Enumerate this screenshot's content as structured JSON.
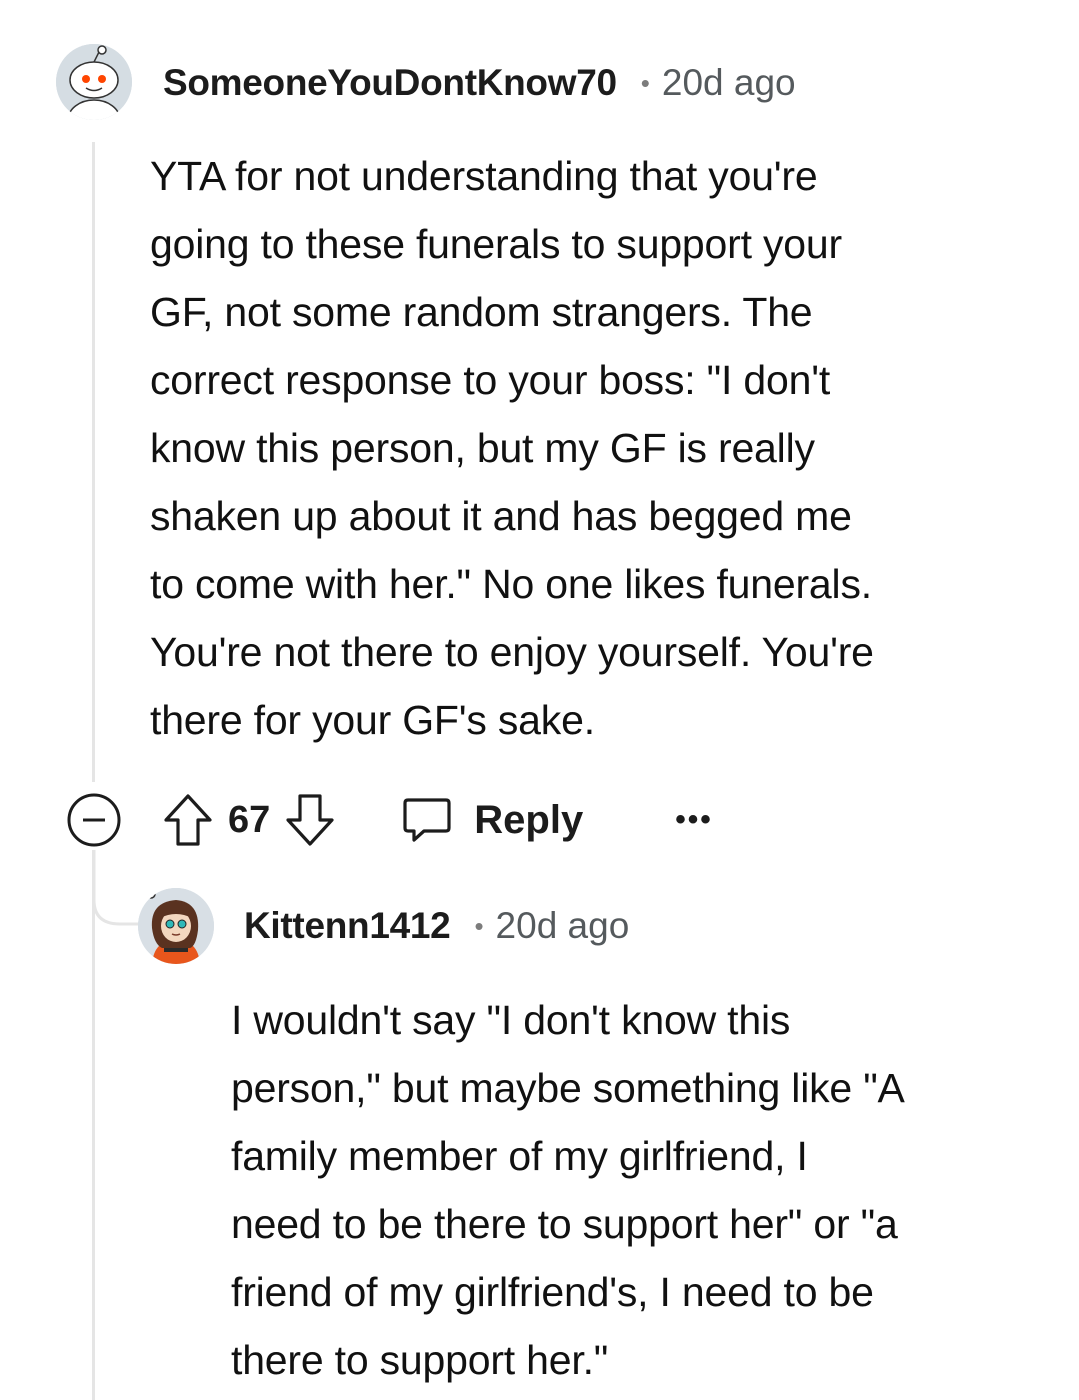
{
  "comment": {
    "username": "SomeoneYouDontKnow70",
    "separator": "•",
    "time": "20d ago",
    "lines": [
      "YTA for not understanding that you're",
      "going to these funerals to support your",
      "GF, not some random strangers. The",
      "correct response to your boss: \"I don't",
      "know this person, but my GF is really",
      "shaken up about it and has begged me",
      "to come with her.\" No one likes funerals.",
      "You're not there to enjoy yourself. You're",
      "there for your GF's sake."
    ],
    "avatar_icon": "snoo-avatar-icon",
    "actions": {
      "collapse_icon": "collapse-minus-icon",
      "upvote_icon": "upvote-arrow-icon",
      "vote_count": "67",
      "downvote_icon": "downvote-arrow-icon",
      "reply_icon": "speech-bubble-icon",
      "reply_label": "Reply",
      "more_label": "•••"
    }
  },
  "reply": {
    "username": "Kittenn1412",
    "separator": "•",
    "time": "20d ago",
    "lines": [
      "I wouldn't say \"I don't know this",
      "person,\" but maybe something like \"A",
      "family member of my girlfriend, I",
      "need to be there to support her\" or \"a",
      "friend of my girlfriend's, I need to be",
      "there to support her.\""
    ],
    "avatar_icon": "cartoon-girl-avatar-icon"
  },
  "colors": {
    "thread_line": "#e5e5e5",
    "snoo_accent": "#ff4500",
    "avatar_bg": "#dae0e6",
    "text": "#111111",
    "muted": "#555a5d"
  }
}
